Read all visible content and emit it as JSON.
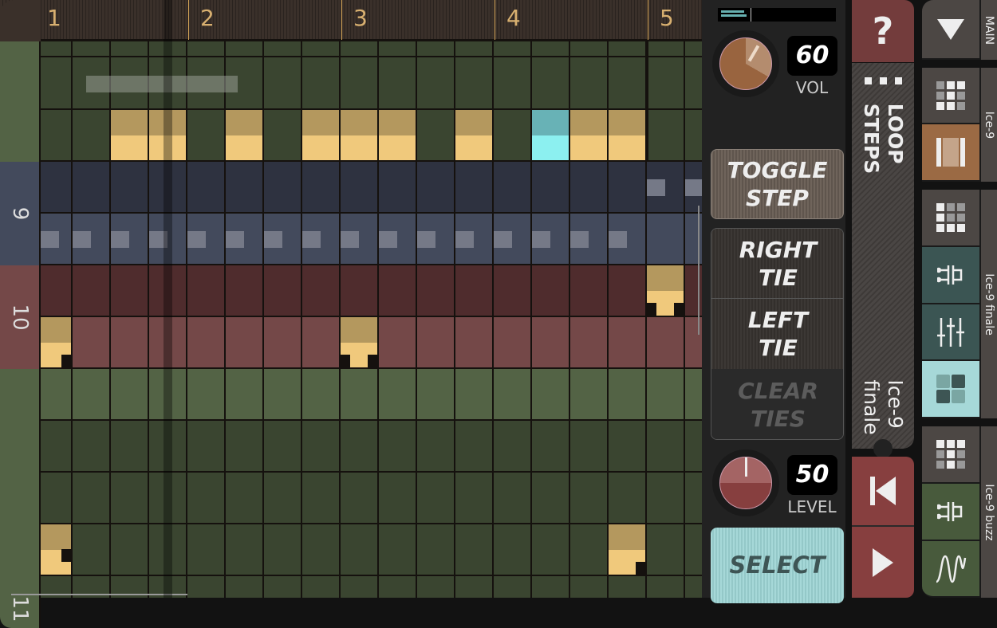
{
  "ruler": {
    "beats": [
      "1",
      "2",
      "3",
      "4",
      "5"
    ]
  },
  "tracks": [
    {
      "label": "",
      "color": "#536345",
      "rows": [
        {
          "bg": "#3a4530",
          "notes": []
        },
        {
          "bg": "#3a4530",
          "notes": []
        },
        {
          "bg": "#3a4530",
          "notes": [
            2,
            3,
            5,
            7,
            8,
            9,
            11,
            13,
            14,
            15
          ],
          "highlight": [
            13
          ]
        }
      ]
    },
    {
      "label": "9",
      "color": "#434a5c",
      "rows": [
        {
          "bg": "#2e3240",
          "dots": [
            16,
            17
          ]
        },
        {
          "bg": "#434a5c",
          "dots": [
            0,
            1,
            2,
            3,
            4,
            5,
            6,
            7,
            8,
            9,
            10,
            11,
            12,
            13,
            14,
            15
          ]
        }
      ]
    },
    {
      "label": "10",
      "color": "#744848",
      "rows": [
        {
          "bg": "#4f2c2d",
          "notes": [
            16
          ],
          "ties": {
            "16": "both"
          }
        },
        {
          "bg": "#744848",
          "notes": [
            0,
            8
          ],
          "ties": {
            "0": "right",
            "8": "both"
          }
        }
      ]
    },
    {
      "label": "11",
      "color": "#536345",
      "rows": [
        {
          "bg": "#536345",
          "notes": []
        },
        {
          "bg": "#3a4530",
          "notes": []
        },
        {
          "bg": "#3a4530",
          "notes": []
        },
        {
          "bg": "#3a4530",
          "notes": [
            0,
            15
          ],
          "ties": {
            "0": "right-mid",
            "15": "right"
          }
        },
        {
          "bg": "#3a4530",
          "notes": []
        }
      ]
    }
  ],
  "meter": {
    "level_percent": 15
  },
  "vol": {
    "value": "60",
    "label": "VOL"
  },
  "level": {
    "value": "50",
    "label": "LEVEL"
  },
  "buttons": {
    "toggle_step": [
      "TOGGLE",
      "STEP"
    ],
    "right_tie": [
      "RIGHT",
      "TIE"
    ],
    "left_tie": [
      "LEFT",
      "TIE"
    ],
    "clear_ties": [
      "CLEAR",
      "TIES"
    ],
    "select": "SELECT",
    "help": "?"
  },
  "loop_steps": {
    "label": [
      "LOOP",
      "STEPS"
    ],
    "pattern_name": [
      "Ice-9",
      "finale"
    ]
  },
  "instruments": [
    {
      "label": "MAIN"
    },
    {
      "label": "Ice-9"
    },
    {
      "label": "Ice-9 finale"
    },
    {
      "label": "Ice-9 buzz"
    }
  ],
  "colors": {
    "note": "#f0c97c",
    "note_playing": "#8cf0f0",
    "accent_red": "#873f3f",
    "select": "#a6d8d8",
    "orange": "#9b6a44"
  }
}
